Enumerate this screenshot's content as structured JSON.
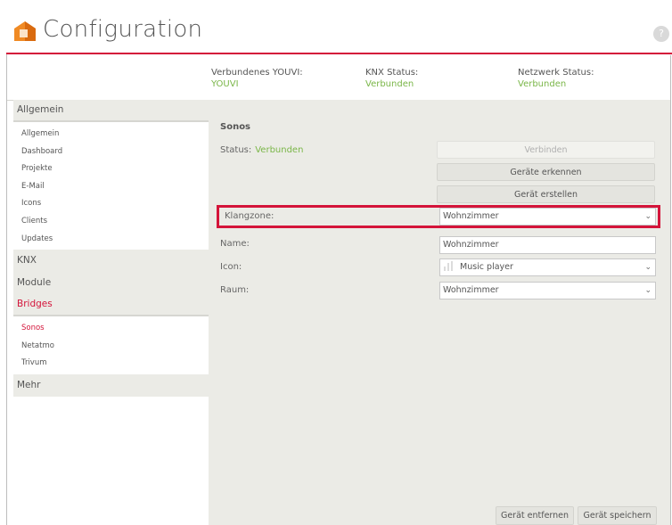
{
  "app": {
    "title": "Configuration",
    "help_label": "?"
  },
  "status_bar": [
    {
      "label": "Verbundenes YOUVI:",
      "value": "YOUVI"
    },
    {
      "label": "KNX Status:",
      "value": "Verbunden"
    },
    {
      "label": "Netzwerk Status:",
      "value": "Verbunden"
    }
  ],
  "sidebar": {
    "sections": [
      {
        "title": "Allgemein",
        "items": [
          "Allgemein",
          "Dashboard",
          "Projekte",
          "E-Mail",
          "Icons",
          "Clients",
          "Updates"
        ]
      },
      {
        "title": "KNX",
        "items": []
      },
      {
        "title": "Module",
        "items": []
      },
      {
        "title": "Bridges",
        "active": true,
        "items": [
          "Sonos",
          "Netatmo",
          "Trivum"
        ],
        "active_item": "Sonos"
      },
      {
        "title": "Mehr",
        "items": []
      }
    ]
  },
  "main": {
    "title": "Sonos",
    "status_label": "Status:",
    "status_value": "Verbunden",
    "buttons": {
      "connect": "Verbinden",
      "detect": "Geräte erkennen",
      "create": "Gerät erstellen"
    },
    "klangzone": {
      "label": "Klangzone:",
      "value": "Wohnzimmer"
    },
    "name": {
      "label": "Name:",
      "value": "Wohnzimmer"
    },
    "icon": {
      "label": "Icon:",
      "value": "Music player",
      "icon_name": "music-player-icon"
    },
    "raum": {
      "label": "Raum:",
      "value": "Wohnzimmer"
    },
    "footer": {
      "remove": "Gerät entfernen",
      "save": "Gerät speichern"
    }
  },
  "colors": {
    "accent": "#d4143a",
    "ok": "#7ab648",
    "panel": "#ebebe6"
  }
}
